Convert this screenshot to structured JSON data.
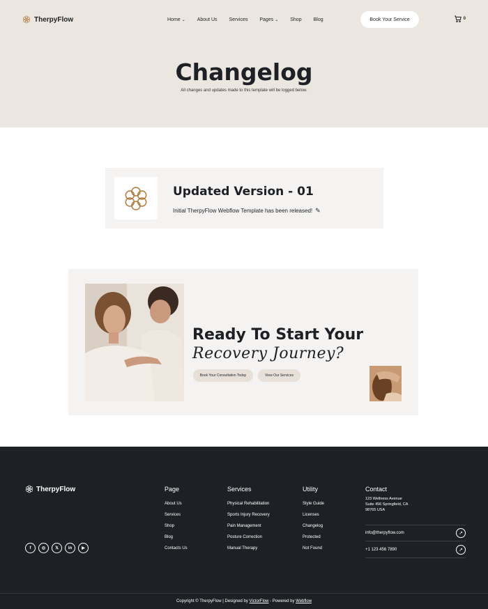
{
  "brand": {
    "name": "TherpyFlow"
  },
  "nav": {
    "items": [
      {
        "label": "Home",
        "dropdown": true
      },
      {
        "label": "About Us",
        "dropdown": false
      },
      {
        "label": "Services",
        "dropdown": false
      },
      {
        "label": "Pages",
        "dropdown": true
      },
      {
        "label": "Shop",
        "dropdown": false
      },
      {
        "label": "Blog",
        "dropdown": false
      }
    ],
    "cta": "Book Your Service",
    "cart_count": "0"
  },
  "hero": {
    "title": "Changelog",
    "subtitle": "All changes and updates made to this template will be logged below."
  },
  "changelog": {
    "title": "Updated Version - 01",
    "description": "Initial TherpyFlow Webflow Template has been released!",
    "icon": "flower-icon"
  },
  "cta": {
    "heading_line1": "Ready To Start Your",
    "heading_line2": "Recovery Journey?",
    "button_primary": "Book Your Consultation Today",
    "button_secondary": "View Our Services"
  },
  "footer": {
    "brand": "TherpyFlow",
    "socials": [
      "facebook-icon",
      "instagram-icon",
      "x-icon",
      "linkedin-icon",
      "youtube-icon"
    ],
    "columns": [
      {
        "title": "Page",
        "items": [
          "About Us",
          "Services",
          "Shop",
          "Blog",
          "Contacts Us"
        ]
      },
      {
        "title": "Services",
        "items": [
          "Physical Rehabilitation",
          "Sports Injury Recovery",
          "Pain Management",
          "Posture Correction",
          "Manual Therapy"
        ]
      },
      {
        "title": "Utility",
        "items": [
          "Style Guide",
          "Licenses",
          "Changelog",
          "Protected",
          "Not Found"
        ]
      }
    ],
    "contact": {
      "title": "Contact",
      "address_line1": "123 Wellness Avenue",
      "address_line2": "Suite 456 Springfield, CA",
      "address_line3": "98765 USA",
      "email": "info@therpyflow.com",
      "phone": "+1 123 456 7890"
    },
    "copyright": {
      "prefix": "Copyright © TherpyFlow | Designed by ",
      "designer": "VictorFlow",
      "middle": " - Powered by ",
      "platform": "Webflow"
    }
  },
  "colors": {
    "hero_bg": "#ebe6e0",
    "card_bg": "#f5f3f1",
    "footer_bg": "#1d2125",
    "accent": "#b07a3c"
  }
}
